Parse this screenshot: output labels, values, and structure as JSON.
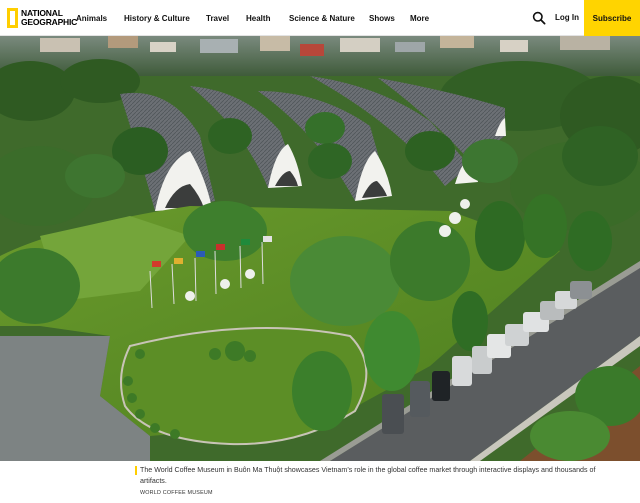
{
  "brand": {
    "line1": "NATIONAL",
    "line2": "GEOGRAPHIC",
    "accent": "#FFCE00"
  },
  "nav": {
    "items": [
      {
        "label": "Animals"
      },
      {
        "label": "History & Culture"
      },
      {
        "label": "Travel"
      },
      {
        "label": "Health"
      },
      {
        "label": "Science & Nature"
      },
      {
        "label": "Shows"
      },
      {
        "label": "More"
      }
    ]
  },
  "header": {
    "search_icon": "search-icon",
    "login_label": "Log In",
    "subscribe_label": "Subscribe",
    "subscribe_color": "#FFD400"
  },
  "hero": {
    "description_icon": "aerial-photo"
  },
  "caption": {
    "text": "The World Coffee Museum in Buôn Ma Thuột showcases Vietnam’s role in the global coffee market through interactive displays and thousands of artifacts.",
    "credit": "WORLD COFFEE MUSEUM"
  }
}
